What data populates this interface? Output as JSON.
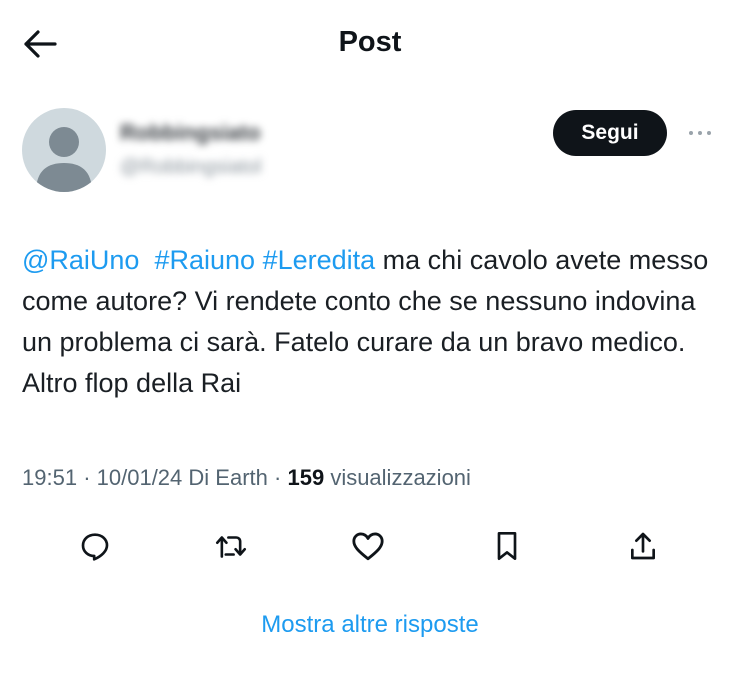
{
  "header": {
    "title": "Post",
    "back_icon": "arrow-left-icon"
  },
  "author": {
    "name": "Robbingsiato",
    "handle": "@Robbingsiatol",
    "avatar_icon": "default-avatar-icon"
  },
  "follow_label": "Segui",
  "more_icon": "more-horizontal-icon",
  "tweet": {
    "mention": "@RaiUno",
    "hashtag1": "#Raiuno",
    "hashtag2": "#Leredita",
    "text": "ma chi cavolo avete messo come autore? Vi rendete conto che se nessuno indovina un problema ci sarà. Fatelo curare da un bravo medico. Altro flop della Rai"
  },
  "meta": {
    "time": "19:51",
    "date": "10/01/24",
    "source": "Di Earth",
    "separator": "·",
    "views_count": "159",
    "views_label": "visualizzazioni"
  },
  "actions": [
    "reply-icon",
    "retweet-icon",
    "like-icon",
    "bookmark-icon",
    "share-icon"
  ],
  "more_replies_label": "Mostra altre risposte",
  "colors": {
    "link": "#1d9bf0",
    "button_bg": "#0f1419",
    "text": "#0f1419",
    "muted": "#536471",
    "avatar_bg": "#cfd9de"
  }
}
